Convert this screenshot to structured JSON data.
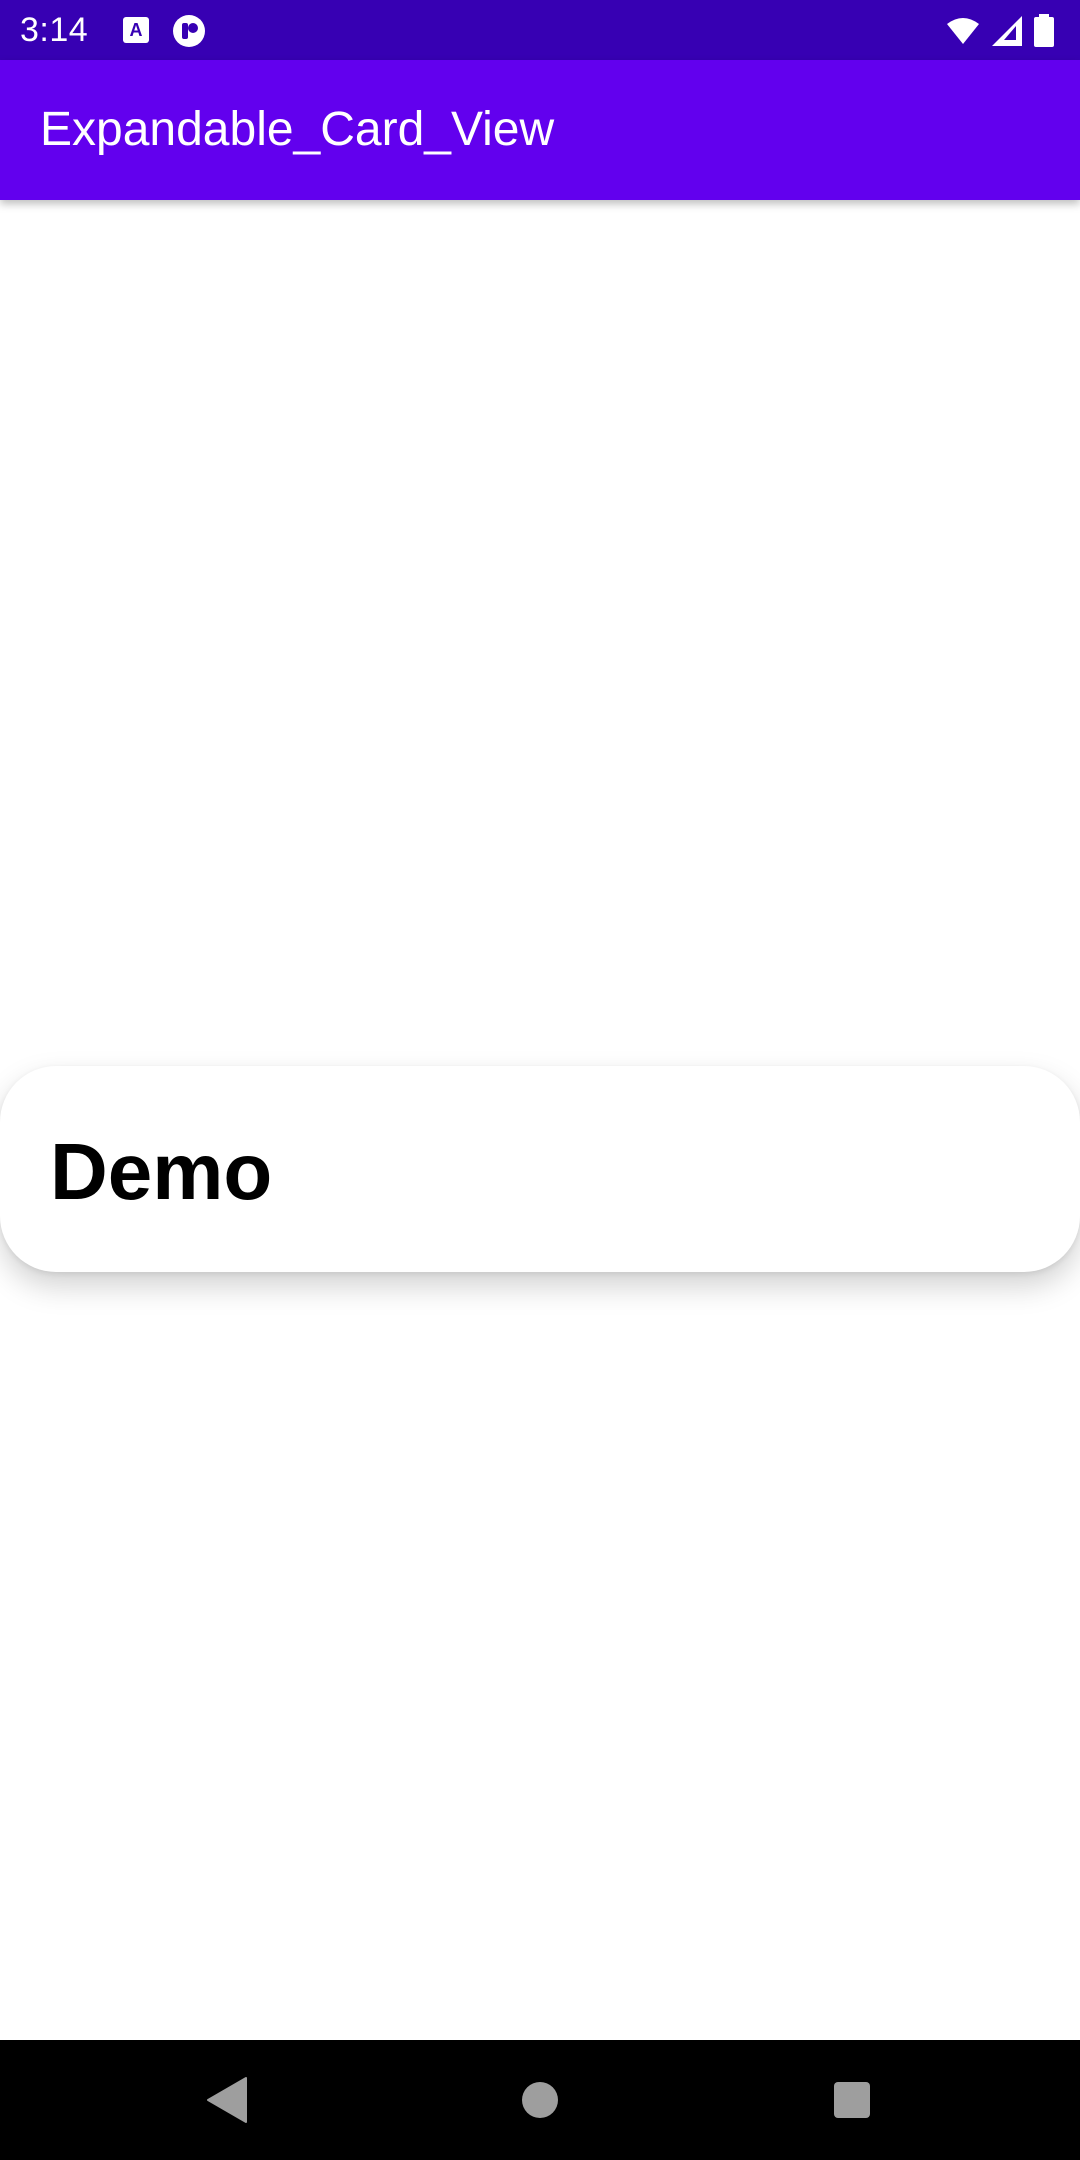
{
  "status_bar": {
    "time": "3:14",
    "icons": [
      "keyboard-a-icon",
      "toggle-icon",
      "wifi-icon",
      "signal-icon",
      "battery-icon"
    ]
  },
  "app_bar": {
    "title": "Expandable_Card_View",
    "color": "#6200ee",
    "status_color": "#3700b3"
  },
  "card": {
    "title": "Demo"
  },
  "nav_bar": {
    "buttons": [
      "back-icon",
      "home-icon",
      "recents-icon"
    ]
  }
}
